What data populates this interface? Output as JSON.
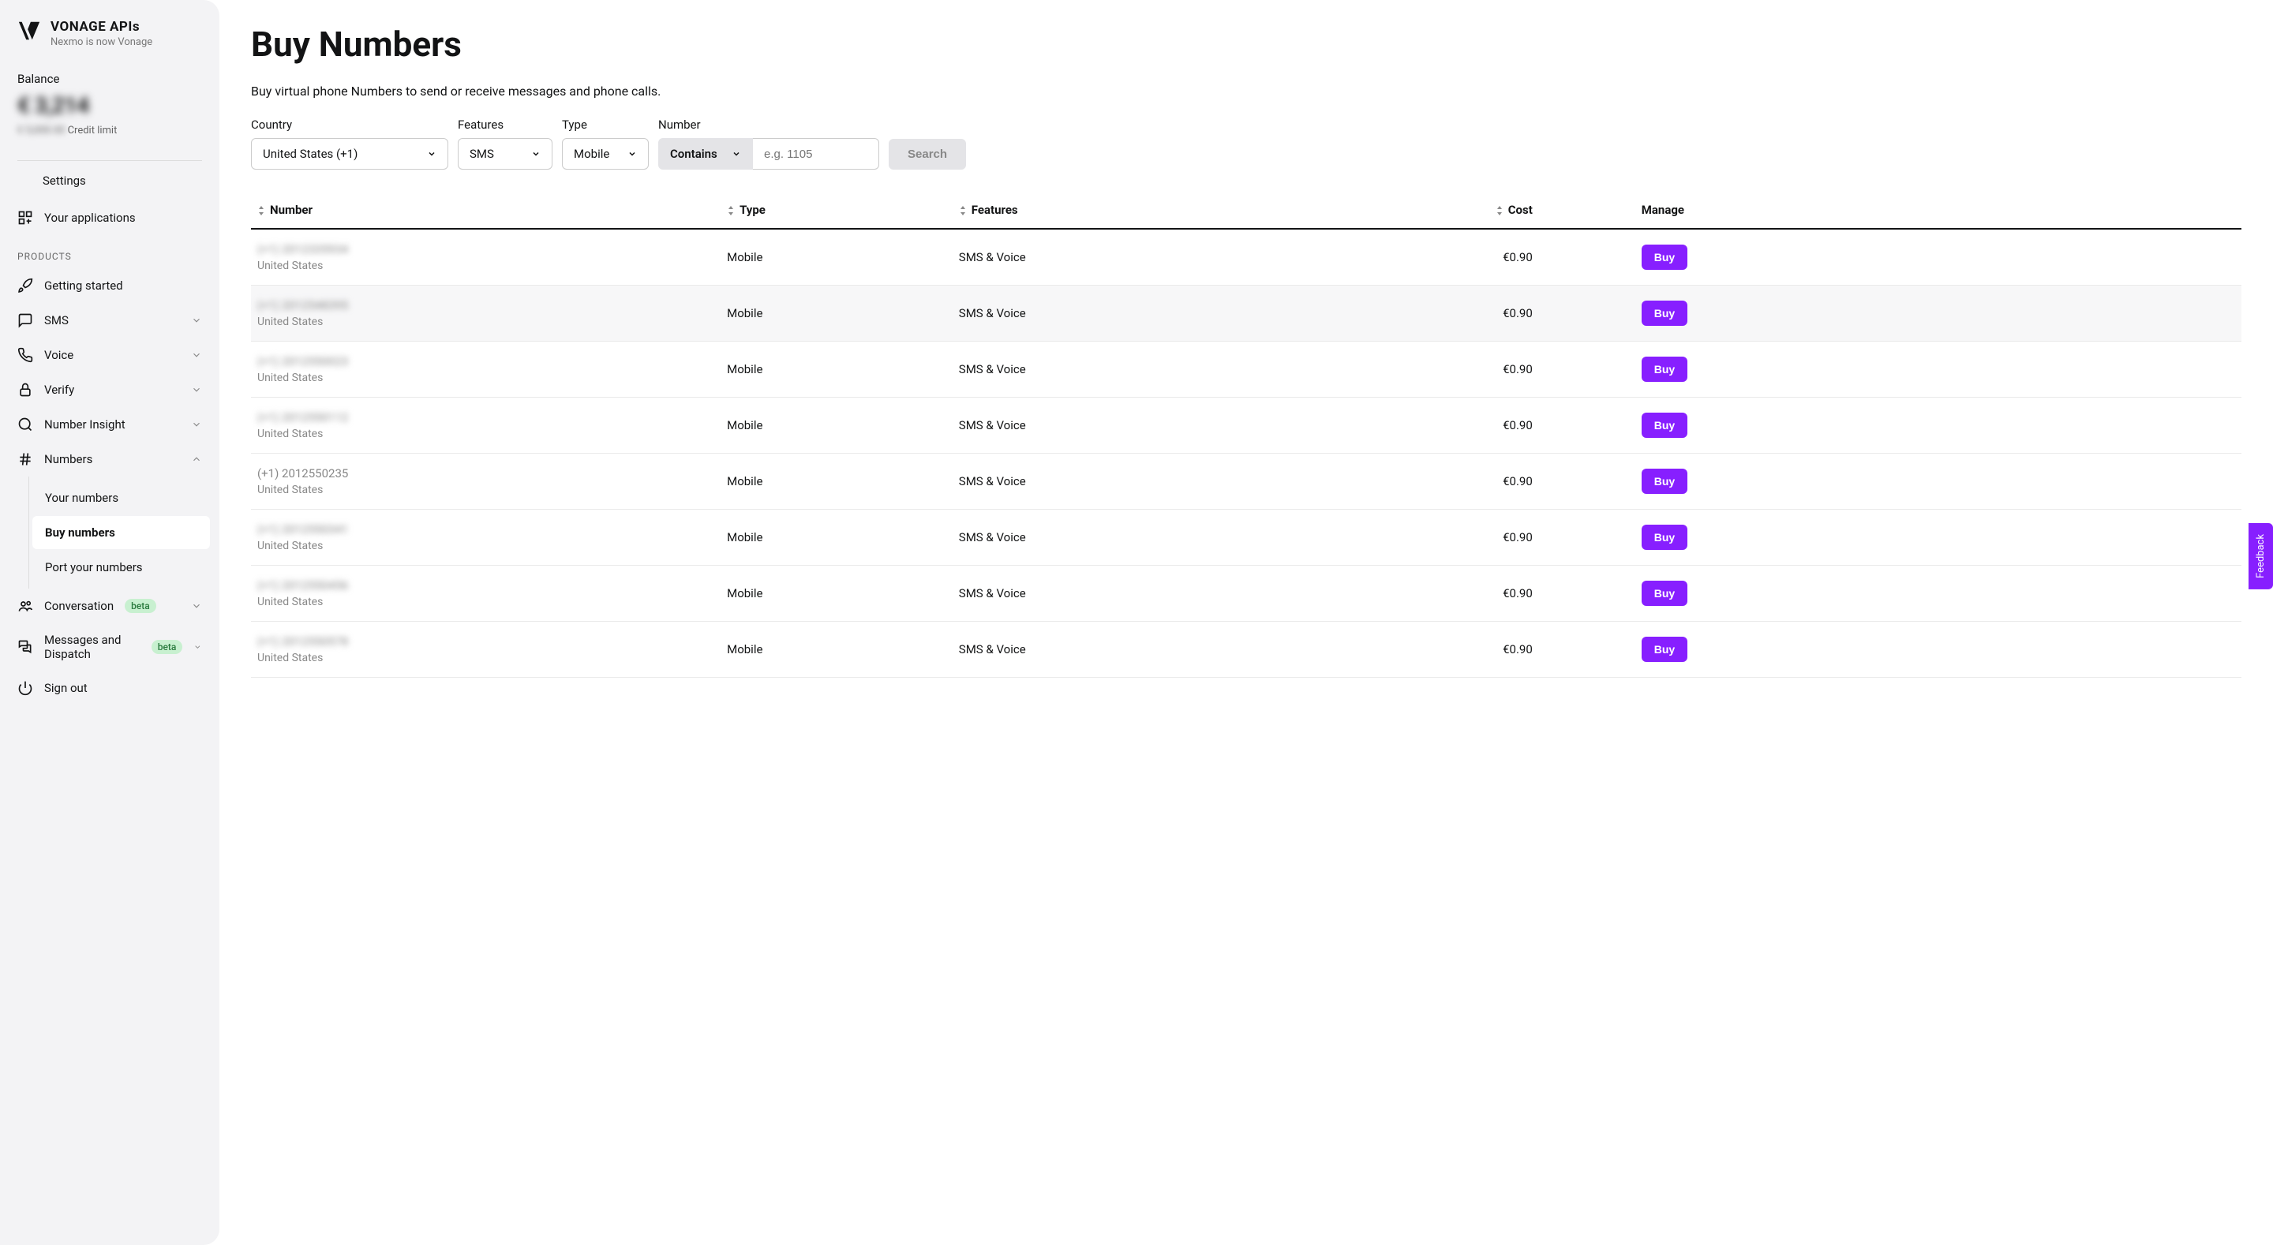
{
  "brand": {
    "title": "VONAGE APIs",
    "subtitle": "Nexmo is now Vonage"
  },
  "balance": {
    "label": "Balance",
    "amount": "€ 3,214",
    "credit_blurred": "€ 5,000.00",
    "credit_suffix": " Credit limit"
  },
  "sidebar": {
    "settings": "Settings",
    "apps": "Your applications",
    "products_heading": "PRODUCTS",
    "getting_started": "Getting started",
    "sms": "SMS",
    "voice": "Voice",
    "verify": "Verify",
    "number_insight": "Number Insight",
    "numbers": "Numbers",
    "numbers_sub": {
      "your_numbers": "Your numbers",
      "buy_numbers": "Buy numbers",
      "port_numbers": "Port your numbers"
    },
    "conversation": "Conversation",
    "messages_dispatch": "Messages and Dispatch",
    "sign_out": "Sign out",
    "beta": "beta"
  },
  "page": {
    "title": "Buy Numbers",
    "description": "Buy virtual phone Numbers to send or receive messages and phone calls."
  },
  "filters": {
    "country_label": "Country",
    "country_value": "United States (+1)",
    "features_label": "Features",
    "features_value": "SMS",
    "type_label": "Type",
    "type_value": "Mobile",
    "number_label": "Number",
    "number_mode": "Contains",
    "number_placeholder": "e.g. 1105",
    "search_label": "Search"
  },
  "table": {
    "cols": {
      "number": "Number",
      "type": "Type",
      "features": "Features",
      "cost": "Cost",
      "manage": "Manage"
    },
    "buy_label": "Buy",
    "rows": [
      {
        "num": "(+1) 2012335934",
        "country": "United States",
        "type": "Mobile",
        "features": "SMS & Voice",
        "cost": "€0.90",
        "clear": false
      },
      {
        "num": "(+1) 2012548395",
        "country": "United States",
        "type": "Mobile",
        "features": "SMS & Voice",
        "cost": "€0.90",
        "clear": false
      },
      {
        "num": "(+1) 2012550023",
        "country": "United States",
        "type": "Mobile",
        "features": "SMS & Voice",
        "cost": "€0.90",
        "clear": false
      },
      {
        "num": "(+1) 2012550112",
        "country": "United States",
        "type": "Mobile",
        "features": "SMS & Voice",
        "cost": "€0.90",
        "clear": false
      },
      {
        "num": "(+1) 2012550235",
        "country": "United States",
        "type": "Mobile",
        "features": "SMS & Voice",
        "cost": "€0.90",
        "clear": true
      },
      {
        "num": "(+1) 2012550341",
        "country": "United States",
        "type": "Mobile",
        "features": "SMS & Voice",
        "cost": "€0.90",
        "clear": false
      },
      {
        "num": "(+1) 2012550456",
        "country": "United States",
        "type": "Mobile",
        "features": "SMS & Voice",
        "cost": "€0.90",
        "clear": false
      },
      {
        "num": "(+1) 2012550578",
        "country": "United States",
        "type": "Mobile",
        "features": "SMS & Voice",
        "cost": "€0.90",
        "clear": false
      }
    ]
  },
  "feedback": "Feedback"
}
